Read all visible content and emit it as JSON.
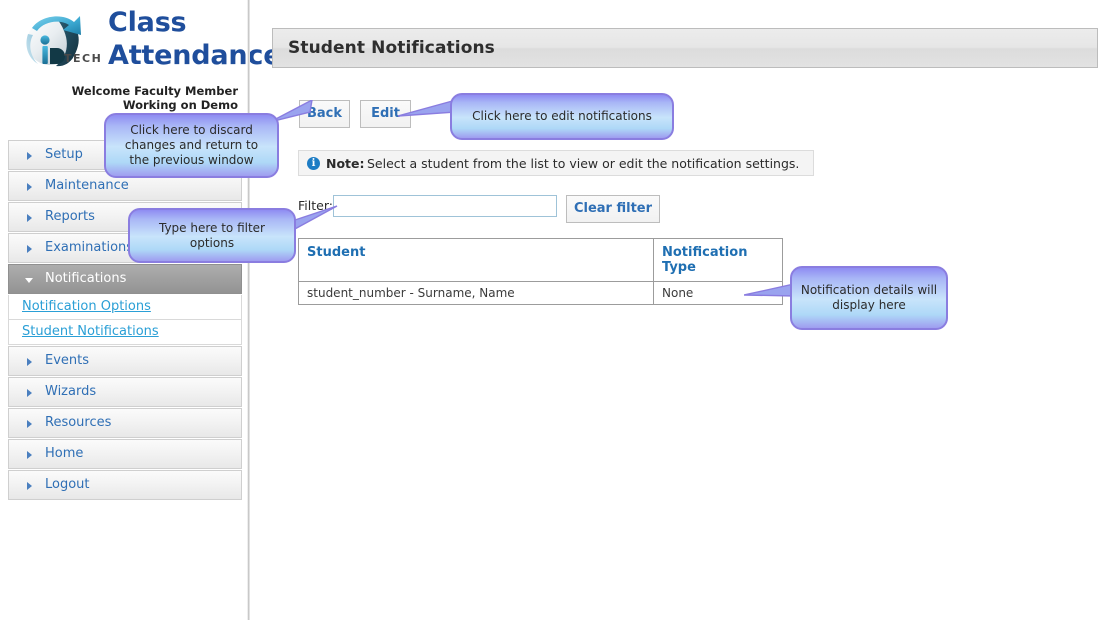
{
  "brand": {
    "logo_icon": "iptech-circular-arrow-logo",
    "logo_text": "TECH",
    "title_line1": "Class",
    "title_line2": "Attendance"
  },
  "welcome": {
    "line1": "Welcome Faculty Member",
    "line2": "Working on Demo"
  },
  "sidebar": {
    "items": [
      {
        "label": "Setup",
        "type": "collapsed",
        "icon": "chevron-right-icon"
      },
      {
        "label": "Maintenance",
        "type": "collapsed",
        "icon": "chevron-right-icon"
      },
      {
        "label": "Reports",
        "type": "collapsed",
        "icon": "chevron-right-icon"
      },
      {
        "label": "Examinations",
        "type": "collapsed",
        "icon": "chevron-right-icon"
      },
      {
        "label": "Notifications",
        "type": "expanded",
        "icon": "chevron-down-icon"
      },
      {
        "label": "Events",
        "type": "collapsed",
        "icon": "chevron-right-icon"
      },
      {
        "label": "Wizards",
        "type": "collapsed",
        "icon": "chevron-right-icon"
      },
      {
        "label": "Resources",
        "type": "collapsed",
        "icon": "chevron-right-icon"
      },
      {
        "label": "Home",
        "type": "collapsed",
        "icon": "chevron-right-icon"
      },
      {
        "label": "Logout",
        "type": "collapsed",
        "icon": "chevron-right-icon"
      }
    ],
    "sub_items": [
      {
        "label": "Notification Options"
      },
      {
        "label": "Student Notifications"
      }
    ]
  },
  "header": {
    "page_title": "Student Notifications"
  },
  "toolbar": {
    "back_label": "Back",
    "edit_label": "Edit"
  },
  "note": {
    "icon": "info-icon",
    "label": "Note:",
    "text": "Select a student from the list to view or edit the notification settings."
  },
  "filter": {
    "label": "Filter:",
    "value": "",
    "placeholder": "",
    "clear_label": "Clear filter"
  },
  "table": {
    "columns": [
      {
        "header": "Student"
      },
      {
        "header_line1": "Notification",
        "header_line2": "Type"
      }
    ],
    "rows": [
      {
        "student": "student_number - Surname, Name",
        "notification_type": "None"
      }
    ]
  },
  "callouts": [
    {
      "id": "back",
      "text": "Click here to discard changes and return to the previous window"
    },
    {
      "id": "edit",
      "text": "Click here to edit notifications"
    },
    {
      "id": "filter",
      "text": "Type here to filter options"
    },
    {
      "id": "details",
      "text": "Notification details will display here"
    }
  ],
  "colors": {
    "brand_blue": "#1f4e9c",
    "link_blue": "#2a9fd6",
    "menu_text": "#2f6fb5",
    "callout_border": "#8a7de0",
    "info_icon": "#1d7cc4",
    "table_header": "#1f6fb2"
  }
}
